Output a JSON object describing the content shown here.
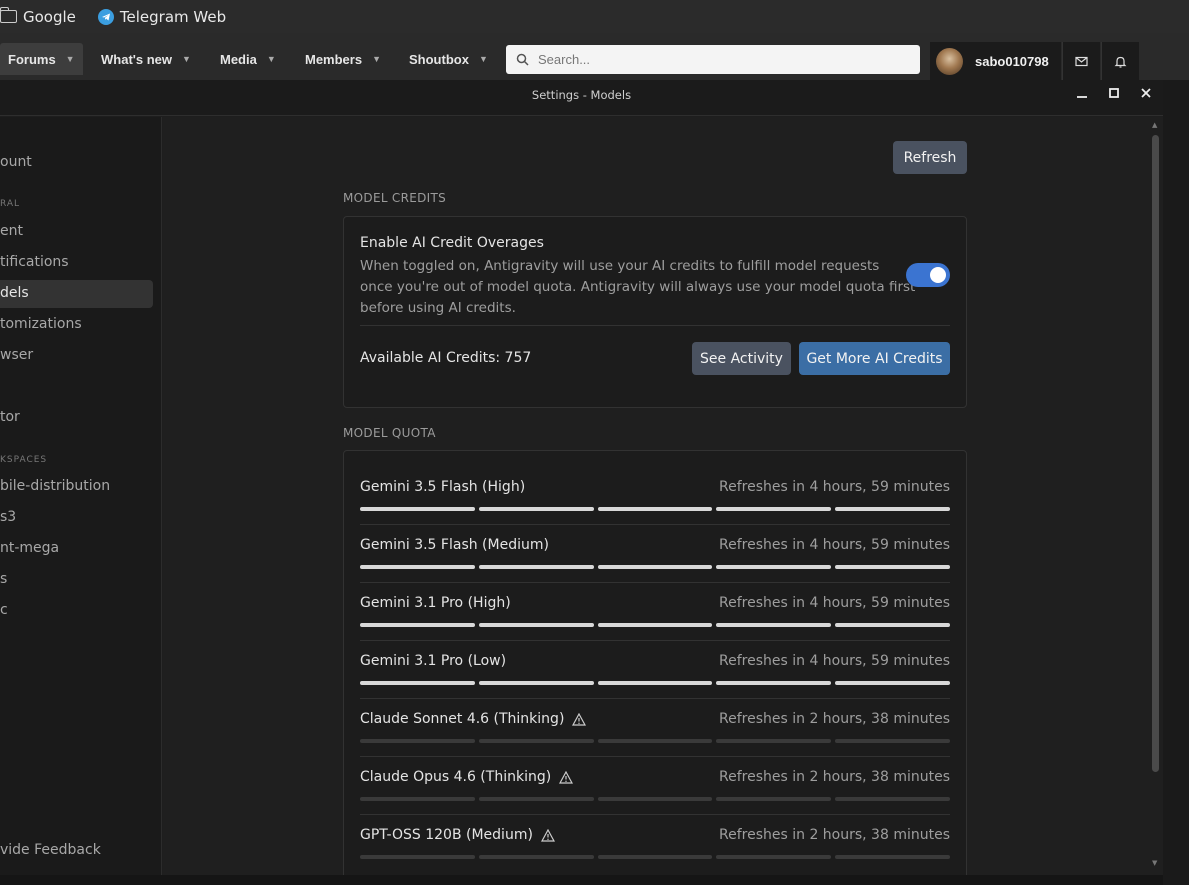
{
  "bookmarks": [
    {
      "label": "Google",
      "icon": "folder-icon"
    },
    {
      "label": "Telegram Web",
      "icon": "telegram-icon"
    }
  ],
  "forum_nav": {
    "tabs": [
      {
        "label": "Forums",
        "active": true
      },
      {
        "label": "What's new"
      },
      {
        "label": "Media"
      },
      {
        "label": "Members"
      },
      {
        "label": "Shoutbox"
      }
    ],
    "search_placeholder": "Search...",
    "username": "sabo010798"
  },
  "window": {
    "title": "Settings - Models"
  },
  "sidebar": {
    "items": [
      "ount",
      "ent",
      "tifications",
      "dels",
      "tomizations",
      "wser",
      "tor",
      "bile-distribution",
      "s3",
      "nt-mega",
      "s",
      "c"
    ],
    "headers": [
      "RAL",
      "KSPACES"
    ],
    "feedback": "vide Feedback"
  },
  "main": {
    "refresh_label": "Refresh",
    "credits_section": "MODEL CREDITS",
    "overage_title": "Enable AI Credit Overages",
    "overage_desc_1": "When toggled on, Antigravity will use your AI credits to fulfill model requests",
    "overage_desc_2": "once you're out of model quota. Antigravity will always use your model quota first",
    "overage_desc_3": "before using AI credits.",
    "overage_enabled": true,
    "available_credits": "Available AI Credits: 757",
    "see_activity": "See Activity",
    "get_more": "Get More AI Credits",
    "quota_section": "MODEL QUOTA",
    "models": [
      {
        "name": "Gemini 3.5 Flash (High)",
        "refresh": "Refreshes in 4 hours, 59 minutes",
        "quota": 1.0,
        "warning": false
      },
      {
        "name": "Gemini 3.5 Flash (Medium)",
        "refresh": "Refreshes in 4 hours, 59 minutes",
        "quota": 1.0,
        "warning": false
      },
      {
        "name": "Gemini 3.1 Pro (High)",
        "refresh": "Refreshes in 4 hours, 59 minutes",
        "quota": 1.0,
        "warning": false
      },
      {
        "name": "Gemini 3.1 Pro (Low)",
        "refresh": "Refreshes in 4 hours, 59 minutes",
        "quota": 1.0,
        "warning": false
      },
      {
        "name": "Claude Sonnet 4.6 (Thinking)",
        "refresh": "Refreshes in 2 hours, 38 minutes",
        "quota": 0.0,
        "warning": true
      },
      {
        "name": "Claude Opus 4.6 (Thinking)",
        "refresh": "Refreshes in 2 hours, 38 minutes",
        "quota": 0.0,
        "warning": true
      },
      {
        "name": "GPT-OSS 120B (Medium)",
        "refresh": "Refreshes in 2 hours, 38 minutes",
        "quota": 0.0,
        "warning": true
      }
    ]
  }
}
